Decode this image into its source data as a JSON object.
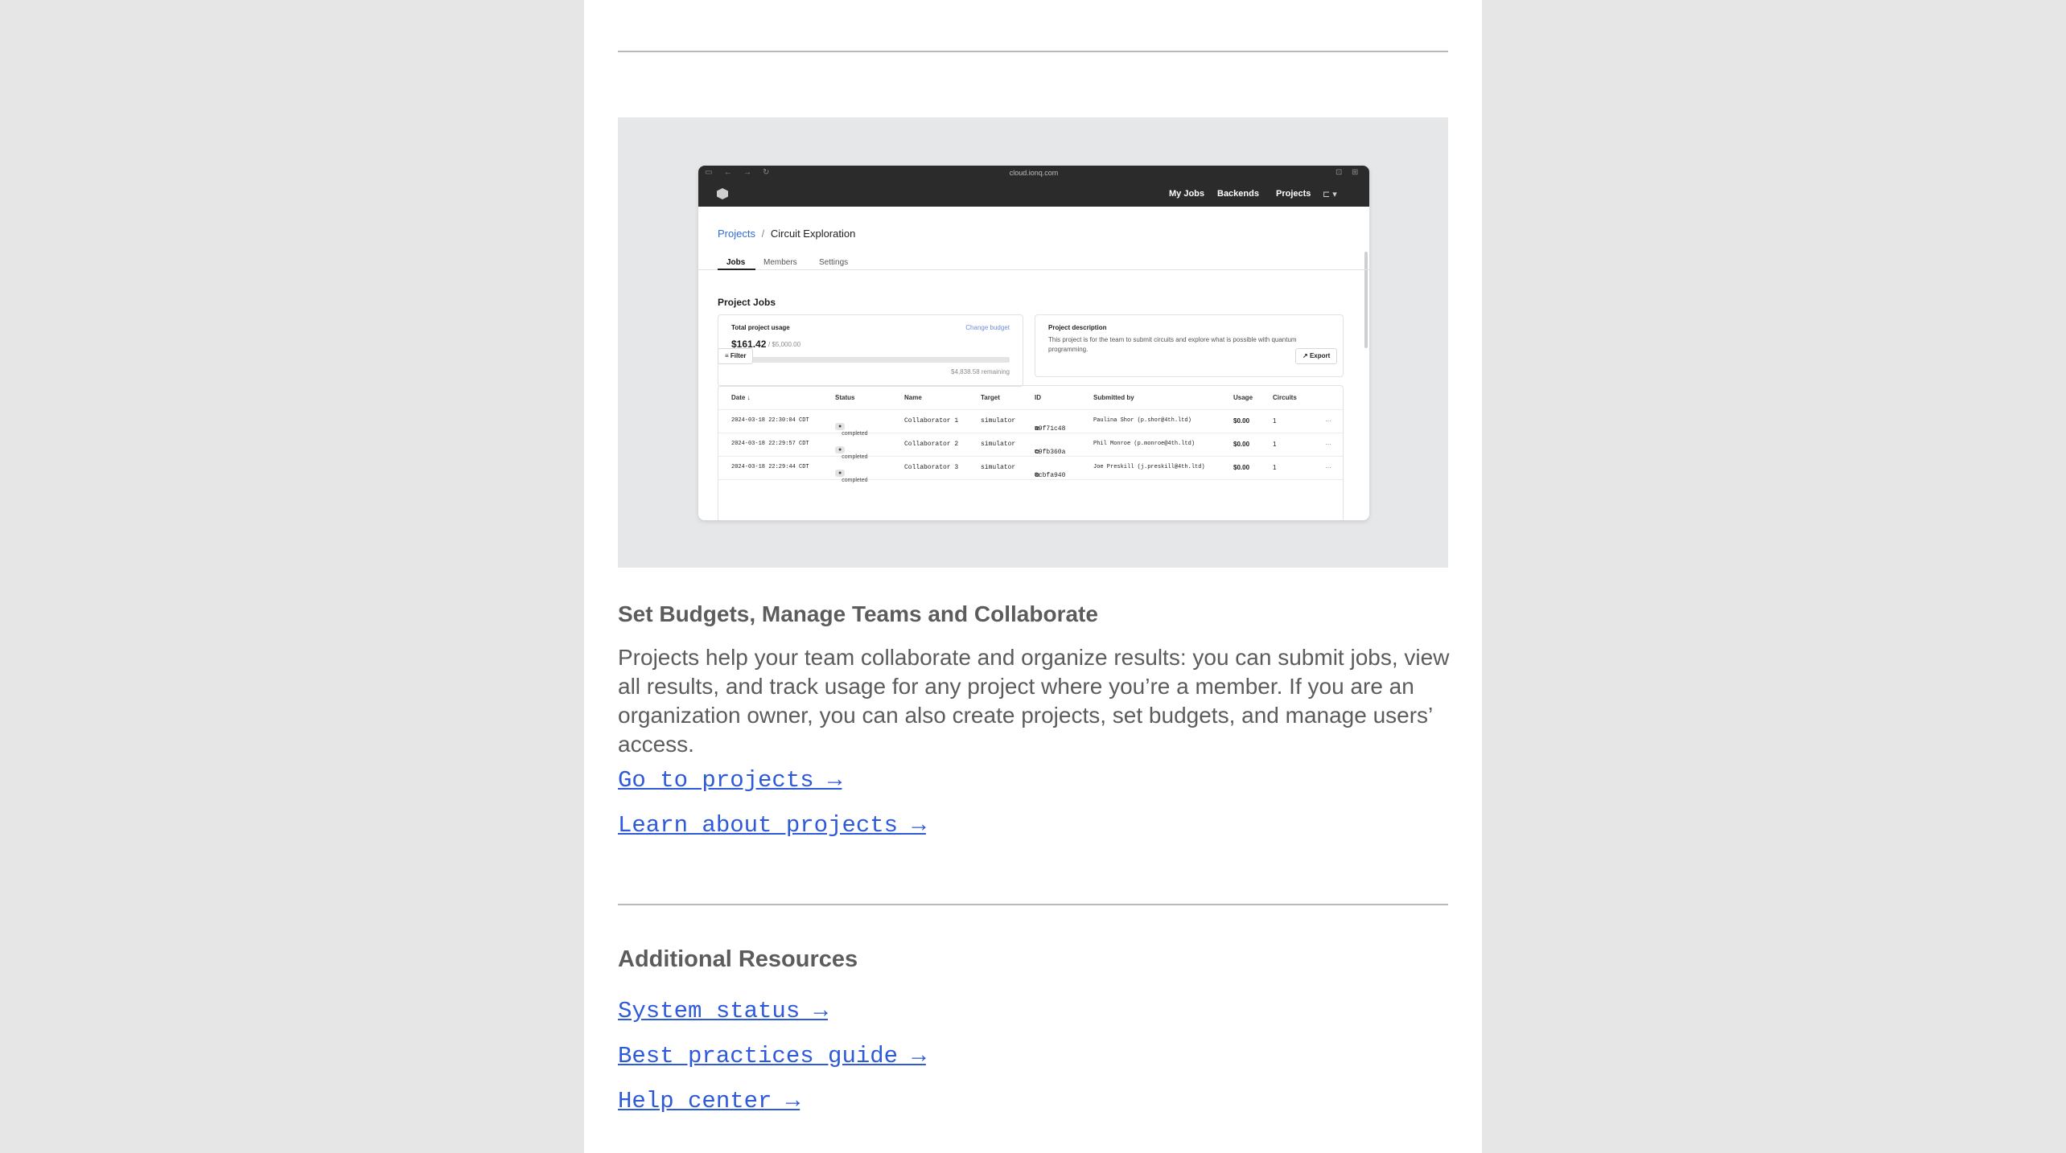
{
  "section": {
    "heading": "Set Budgets, Manage Teams and Collaborate",
    "body": "Projects help your team collaborate and organize results: you can submit jobs, view all results, and track usage for any project where you’re a member. If you are an organization owner, you can also create projects, set budgets, and manage users’ access.",
    "links": [
      "Go to projects →",
      "Learn about projects →"
    ]
  },
  "resources": {
    "heading": "Additional Resources",
    "links": [
      "System status →",
      "Best practices guide →",
      "Help center →"
    ]
  },
  "screenshot": {
    "browser_url": "cloud.ionq.com",
    "nav": [
      "My Jobs",
      "Backends",
      "Projects"
    ],
    "breadcrumb_root": "Projects",
    "breadcrumb_sep": "/",
    "breadcrumb_current": "Circuit Exploration",
    "tabs": [
      "Jobs",
      "Members",
      "Settings"
    ],
    "section_title": "Project Jobs",
    "usage": {
      "label": "Total project usage",
      "change_budget": "Change budget",
      "amount": "$161.42",
      "budget": "/ $5,000.00",
      "remaining": "$4,838.58 remaining",
      "fraction": 0.032
    },
    "description": {
      "label": "Project description",
      "text": "This project is for the team to submit circuits and explore what is possible with quantum programming."
    },
    "filter_label": "Filter",
    "export_label": "Export",
    "columns": [
      "Date ↓",
      "Status",
      "Name",
      "Target",
      "ID",
      "Submitted by",
      "Usage",
      "Circuits"
    ],
    "rows": [
      {
        "date": "2024-03-18 22:30:04 CDT",
        "status": "completed",
        "name": "Collaborator 1",
        "target": "simulator",
        "id": "a9f71c48",
        "by": "Paulina Shor (p.shor@4th.ltd)",
        "usage": "$0.00",
        "circuits": "1"
      },
      {
        "date": "2024-03-18 22:29:57 CDT",
        "status": "completed",
        "name": "Collaborator 2",
        "target": "simulator",
        "id": "c9fb360a",
        "by": "Phil Monroe (p.monroe@4th.ltd)",
        "usage": "$0.00",
        "circuits": "1"
      },
      {
        "date": "2024-03-18 22:29:44 CDT",
        "status": "completed",
        "name": "Collaborator 3",
        "target": "simulator",
        "id": "0cbfa940",
        "by": "Joe Preskill (j.preskill@4th.ltd)",
        "usage": "$0.00",
        "circuits": "1"
      }
    ]
  }
}
